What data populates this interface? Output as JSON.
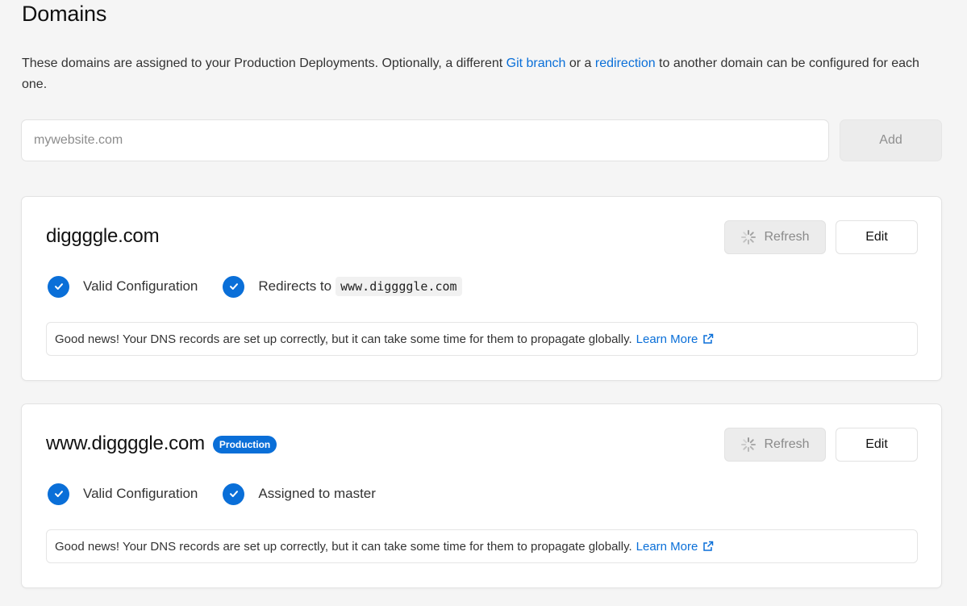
{
  "header": {
    "title": "Domains",
    "intro_prefix": "These domains are assigned to your Production Deployments. Optionally, a different ",
    "intro_link_git": "Git branch",
    "intro_middle": " or a ",
    "intro_link_redirect": "redirection",
    "intro_suffix": " to another domain can be configured for each one."
  },
  "add_form": {
    "placeholder": "mywebsite.com",
    "value": "",
    "add_label": "Add"
  },
  "domains": [
    {
      "name": "diggggle.com",
      "badge": "",
      "refresh_label": "Refresh",
      "edit_label": "Edit",
      "status_1": "Valid Configuration",
      "status_2_text": "Redirects to",
      "status_2_code": "www.diggggle.com",
      "note": "Good news! Your DNS records are set up correctly, but it can take some time for them to propagate globally.",
      "learn_more": "Learn More"
    },
    {
      "name": "www.diggggle.com",
      "badge": "Production",
      "refresh_label": "Refresh",
      "edit_label": "Edit",
      "status_1": "Valid Configuration",
      "status_2_text": "Assigned to master",
      "status_2_code": "",
      "note": "Good news! Your DNS records are set up correctly, but it can take some time for them to propagate globally.",
      "learn_more": "Learn More"
    }
  ],
  "colors": {
    "accent": "#0a6fd8",
    "background": "#f5f5f5",
    "card": "#ffffff"
  },
  "icons": {
    "check": "check-circle-icon",
    "spinner": "spinner-icon",
    "external": "external-link-icon"
  }
}
